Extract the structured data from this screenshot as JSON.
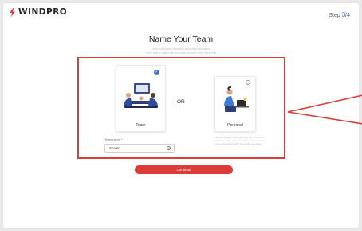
{
  "brand": {
    "name": "WINDPRO",
    "logo_icon": "lightning-bolt-icon",
    "color": "#d9403a"
  },
  "progress": {
    "label": "Step ",
    "current": "3",
    "total_text": "/4"
  },
  "page": {
    "title": "Name Your Team",
    "subtitle_line1": "Give to your team name first and create information",
    "subtitle_line2": "You're able to switch with your name yourself on the back page"
  },
  "options": {
    "team": {
      "label": "Team",
      "selected": true,
      "icon": "team-meeting-illustration"
    },
    "separator": "OR",
    "personal": {
      "label": "Personal",
      "selected": false,
      "icon": "person-laptop-illustration"
    }
  },
  "team_name_field": {
    "label": "Team name *",
    "value": "Scalen"
  },
  "personal_description": "When the team holds and you can create the option to invite, share you later. And for those team information with your team members.",
  "continue_button": {
    "label": "Continue",
    "color": "#dc3b36"
  },
  "accent_colors": {
    "selection_blue": "#3b73d6",
    "annotation_red": "#d9403a"
  }
}
